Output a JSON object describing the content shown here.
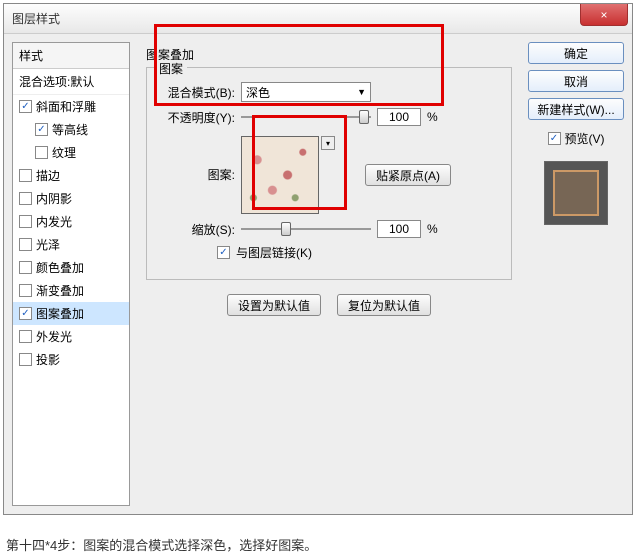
{
  "dialog": {
    "title": "图层样式",
    "close": "×"
  },
  "sidebar": {
    "header": "样式",
    "subheader": "混合选项:默认",
    "items": [
      {
        "label": "斜面和浮雕",
        "checked": true
      },
      {
        "label": "等高线",
        "checked": true,
        "indent": true
      },
      {
        "label": "纹理",
        "checked": false,
        "indent": true
      },
      {
        "label": "描边",
        "checked": false
      },
      {
        "label": "内阴影",
        "checked": false
      },
      {
        "label": "内发光",
        "checked": false
      },
      {
        "label": "光泽",
        "checked": false
      },
      {
        "label": "颜色叠加",
        "checked": false
      },
      {
        "label": "渐变叠加",
        "checked": false
      },
      {
        "label": "图案叠加",
        "checked": true,
        "selected": true
      },
      {
        "label": "外发光",
        "checked": false
      },
      {
        "label": "投影",
        "checked": false
      }
    ]
  },
  "main": {
    "section_title": "图案叠加",
    "legend": "图案",
    "blend_label": "混合模式(B):",
    "blend_value": "深色",
    "opacity_label": "不透明度(Y):",
    "opacity_value": "100",
    "percent": "%",
    "pattern_label": "图案:",
    "snap_btn": "贴紧原点(A)",
    "scale_label": "缩放(S):",
    "scale_value": "100",
    "link_label": "与图层链接(K)",
    "link_checked": "✓",
    "set_default": "设置为默认值",
    "reset_default": "复位为默认值"
  },
  "right": {
    "ok": "确定",
    "cancel": "取消",
    "new_style": "新建样式(W)...",
    "preview_label": "预览(V)",
    "preview_checked": "✓"
  },
  "caption": "第十四*4步：图案的混合模式选择深色，选择好图案。"
}
